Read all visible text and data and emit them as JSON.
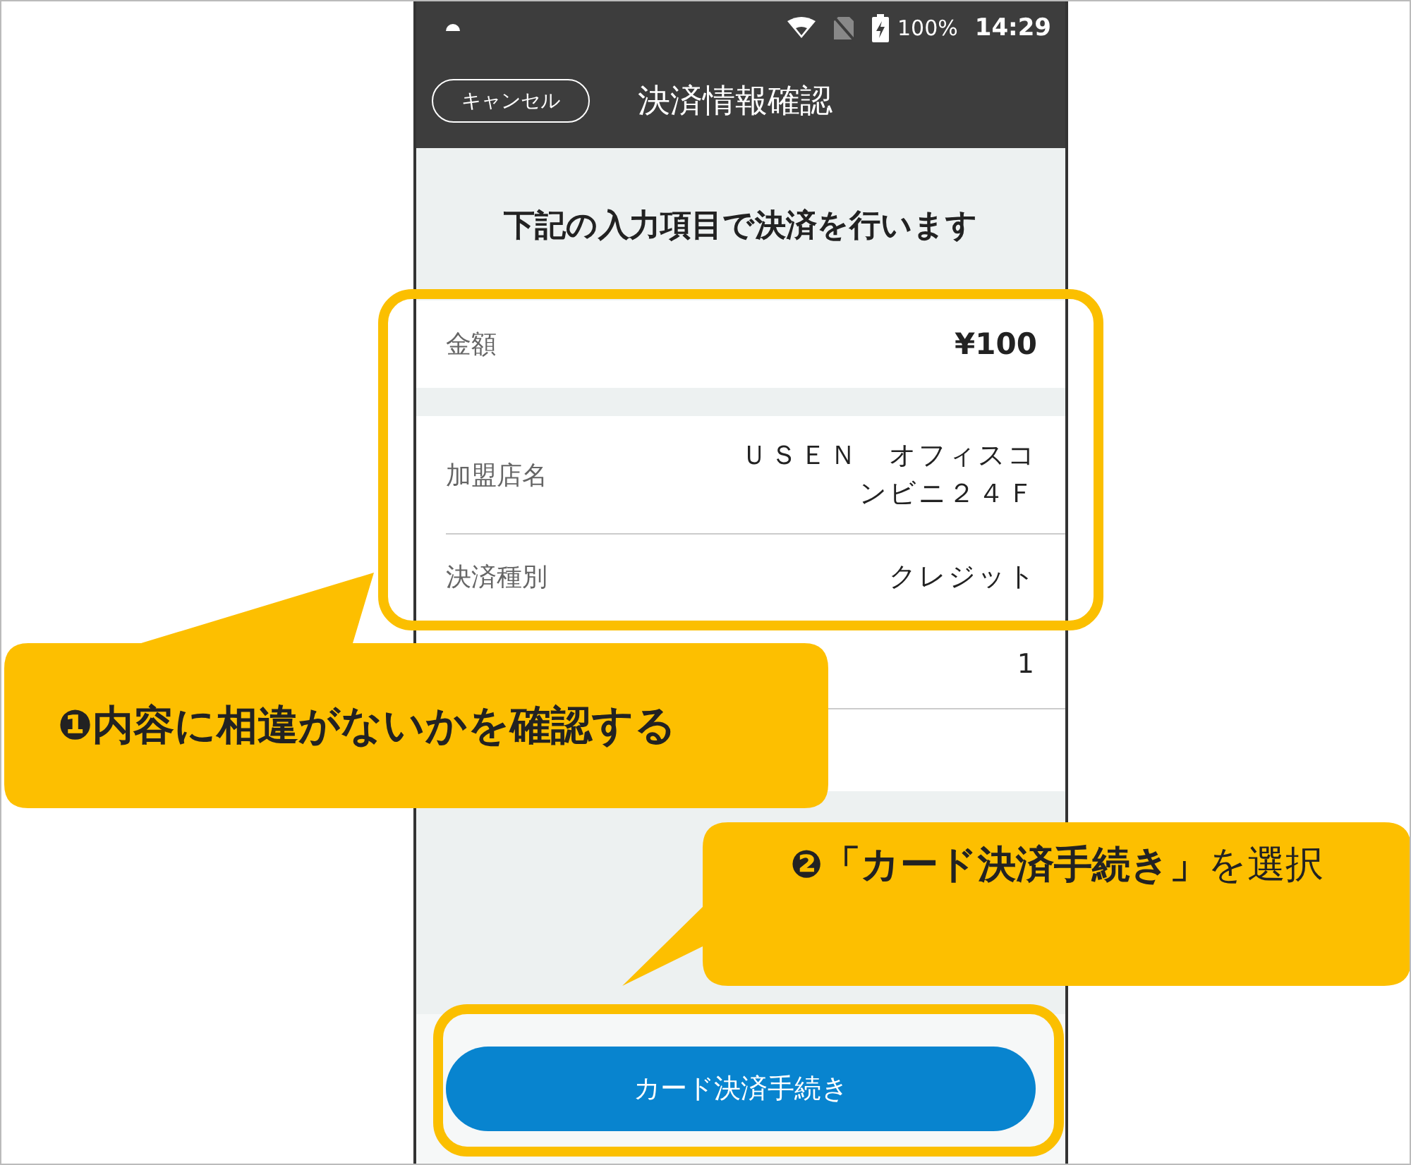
{
  "status_bar": {
    "battery": "100%",
    "time": "14:29"
  },
  "header": {
    "cancel_button": "キャンセル",
    "title": "決済情報確認"
  },
  "heading": "下記の入力項目で決済を行います",
  "rows": [
    {
      "kind": "amount",
      "label": "金額",
      "value": "¥100"
    },
    {
      "kind": "text",
      "label": "加盟店名",
      "value": "ＵＳＥＮ　オフィスコンビニ２４Ｆ"
    },
    {
      "kind": "text",
      "label": "決済種別",
      "value": "クレジット"
    },
    {
      "kind": "text",
      "value": "1"
    },
    {
      "kind": "blank"
    }
  ],
  "pay_button": "カード決済手続き",
  "callouts": [
    {
      "text": "❶内容に相違がないかを確認する"
    },
    {
      "text": "**❷「カード決済手続き」**を選択"
    }
  ]
}
